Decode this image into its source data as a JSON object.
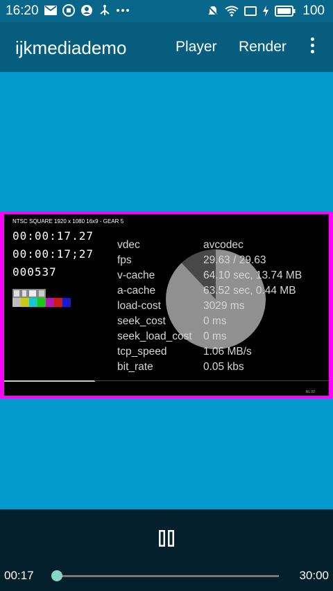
{
  "status_bar": {
    "time": "16:20",
    "left_icons": [
      "mail-icon",
      "download-badge-icon",
      "account-icon",
      "usb-icon",
      "more-dots-icon"
    ],
    "right_icons": [
      "notifications-off-icon",
      "wifi-icon",
      "cast-icon",
      "charging-icon",
      "battery-icon"
    ],
    "battery": "100"
  },
  "app_bar": {
    "title": "ijkmediademo",
    "menu_player": "Player",
    "menu_render": "Render",
    "overflow_icon": "more-vert-icon"
  },
  "video": {
    "header": "NTSC SQUARE  1920 x 1080  16x9  -  GEAR 5",
    "timecode_1": "00:00:17.27",
    "timecode_2": "00:00:17;27",
    "frame_count": "000537",
    "corner_label": "NL 02",
    "pie_fraction": 0.12,
    "progress_fraction": 0.28
  },
  "stats": [
    {
      "key": "vdec",
      "value": "avcodec"
    },
    {
      "key": "fps",
      "value": "29.63 / 29.63"
    },
    {
      "key": "v-cache",
      "value": "64.10 sec, 13.74 MB"
    },
    {
      "key": "a-cache",
      "value": "63.52 sec, 0.44 MB"
    },
    {
      "key": "load-cost",
      "value": "3029 ms"
    },
    {
      "key": "seek_cost",
      "value": "0 ms"
    },
    {
      "key": "seek_load_cost",
      "value": "0 ms"
    },
    {
      "key": "tcp_speed",
      "value": "1.06 MB/s"
    },
    {
      "key": "bit_rate",
      "value": "0.05 kbs"
    }
  ],
  "controls": {
    "pause_icon": "pause-icon",
    "current_time": "00:17",
    "total_time": "30:00",
    "seek_fraction": 0.0
  },
  "colors": {
    "status_bar": "#07668a",
    "app_bar": "#075d7d",
    "background": "#0399cc",
    "video_border": "#ff00ff",
    "controls": "#03202c",
    "accent": "#8ad4c8"
  }
}
